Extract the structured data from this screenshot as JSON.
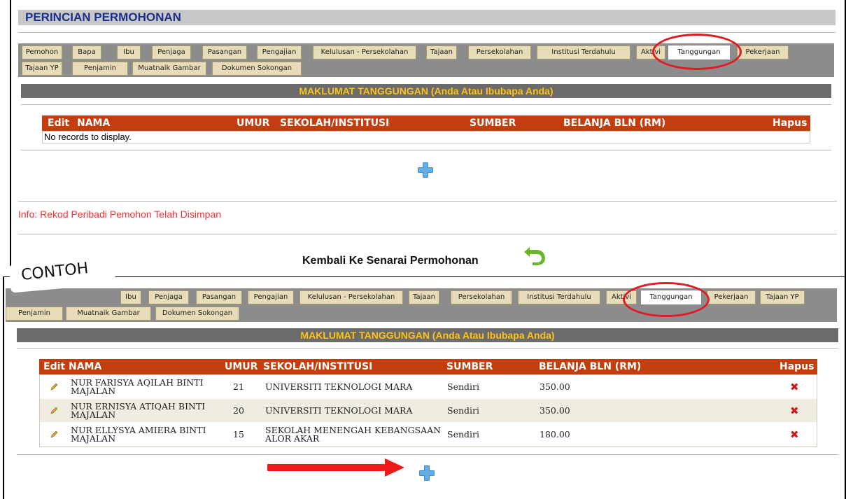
{
  "page_title": "PERINCIAN PERMOHONAN",
  "top_tabs_row1": [
    "Pemohon",
    "Bapa",
    "Ibu",
    "Penjaga",
    "Pasangan",
    "Pengajian",
    "Kelulusan - Persekolahan",
    "Tajaan",
    "Persekolahan",
    "Institusi Terdahulu",
    "Aktivi",
    "Tanggungan",
    "Pekerjaan"
  ],
  "top_tabs_row2": [
    "Tajaan YP",
    "Penjamin",
    "Muatnaik Gambar",
    "Dokumen Sokongan"
  ],
  "bottom_tabs_row1": [
    "Ibu",
    "Penjaga",
    "Pasangan",
    "Pengajian",
    "Kelulusan - Persekolahan",
    "Tajaan",
    "Persekolahan",
    "Institusi Terdahulu",
    "Aktivi",
    "Tanggungan",
    "Pekerjaan",
    "Tajaan YP"
  ],
  "bottom_tabs_row2": [
    "Penjamin",
    "Muatnaik Gambar",
    "Dokumen Sokongan"
  ],
  "section_header": "MAKLUMAT TANGGUNGAN (Anda Atau Ibubapa Anda)",
  "columns": {
    "edit": "Edit",
    "nama": "NAMA",
    "umur": "UMUR",
    "sekolah": "SEKOLAH/INSTITUSI",
    "sumber": "SUMBER",
    "belanja": "BELANJA BLN (RM)",
    "hapus": "Hapus"
  },
  "empty_message": "No records to display.",
  "info_message": "Info: Rekod Peribadi Pemohon Telah Disimpan",
  "back_link": "Kembali Ke Senarai Permohonan",
  "example_label": "CONTOH",
  "rows": [
    {
      "nama_1": "NUR FARISYA AQILAH BINTI",
      "nama_2": "MAJALAN",
      "umur": "21",
      "sekolah_1": "UNIVERSITI TEKNOLOGI MARA",
      "sekolah_2": "",
      "sumber": "Sendiri",
      "belanja": "350.00"
    },
    {
      "nama_1": "NUR ERNISYA ATIQAH BINTI",
      "nama_2": "MAJALAN",
      "umur": "20",
      "sekolah_1": "UNIVERSITI TEKNOLOGI MARA",
      "sekolah_2": "",
      "sumber": "Sendiri",
      "belanja": "350.00"
    },
    {
      "nama_1": "NUR ELLYSYA AMIERA BINTI",
      "nama_2": "MAJALAN",
      "umur": "15",
      "sekolah_1": "SEKOLAH MENENGAH KEBANGSAAN",
      "sekolah_2": "ALOR AKAR",
      "sumber": "Sendiri",
      "belanja": "180.00"
    }
  ],
  "delete_glyph": "✖",
  "colors": {
    "accent": "#c33d0e",
    "header_text": "#ffc21a",
    "highlight": "#e01b24",
    "info": "#e33333",
    "title": "#1a2f8c"
  }
}
